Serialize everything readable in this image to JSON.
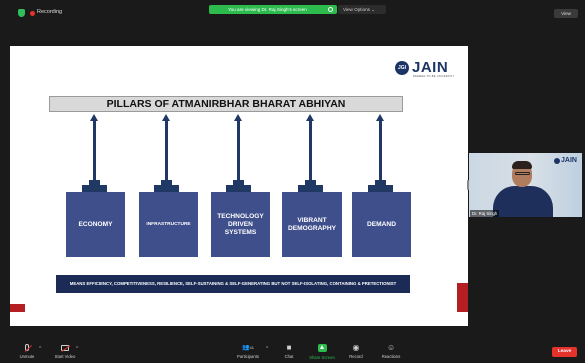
{
  "topbar": {
    "recording_label": "Recording",
    "viewing_banner": "You are viewing Dr. Raj Singh's screen",
    "view_options_label": "View Options ⌄",
    "view_button_label": "View"
  },
  "slide": {
    "logo_text": "JAIN",
    "logo_badge": "JGI",
    "logo_sub": "DEEMED-TO-BE UNIVERSITY",
    "title": "PILLARS OF ATMANIRBHAR BHARAT ABHIYAN",
    "pillars": [
      {
        "label": "ECONOMY"
      },
      {
        "label": "INFRASTRUCTURE"
      },
      {
        "label": "TECHNOLOGY DRIVEN SYSTEMS"
      },
      {
        "label": "VIBRANT DEMOGRAPHY"
      },
      {
        "label": "DEMAND"
      }
    ],
    "bottom_text": "MEANS EFFICIENCY, COMPETITIVENESS, RESILIENCE, SELF-SUSTAINING & SELF-GENERATING BUT  NOT SELF-ISOLATING, CONTAINING & PRETECTIONIST"
  },
  "video": {
    "participant_name": "Dr. Raj Singh",
    "logo_text": "JAIN"
  },
  "toolbar": {
    "unmute": "Unmute",
    "start_video": "Start Video",
    "participants": "Participants",
    "participants_count": "41",
    "chat": "Chat",
    "share_screen": "Share Screen",
    "record": "Record",
    "reactions": "Reactions",
    "leave": "Leave"
  },
  "colors": {
    "accent_green": "#2dbb4e",
    "leave_red": "#e5322d",
    "pillar_blue": "#3f4f8c",
    "navy": "#1f3864"
  }
}
